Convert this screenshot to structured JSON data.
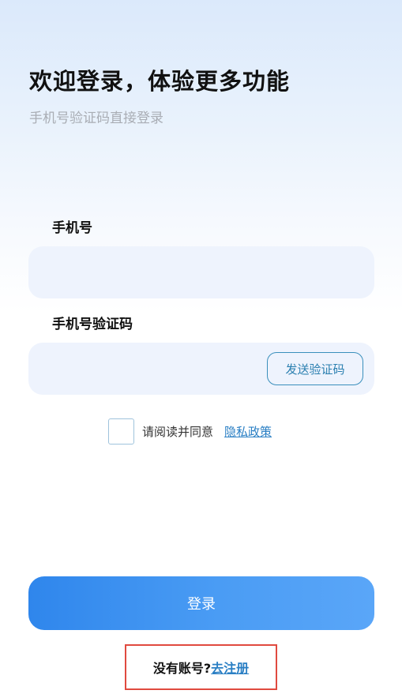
{
  "header": {
    "title": "欢迎登录，体验更多功能",
    "subtitle": "手机号验证码直接登录"
  },
  "form": {
    "phone_label": "手机号",
    "phone_value": "",
    "code_label": "手机号验证码",
    "code_value": "",
    "send_code_label": "发送验证码"
  },
  "agreement": {
    "checked": false,
    "text": "请阅读并同意",
    "link_label": "隐私政策"
  },
  "actions": {
    "login_label": "登录",
    "no_account_text": "没有账号?",
    "register_label": "去注册"
  },
  "colors": {
    "accent": "#2f86ec",
    "link": "#2a7fc4",
    "highlight_border": "#e04a3f"
  }
}
